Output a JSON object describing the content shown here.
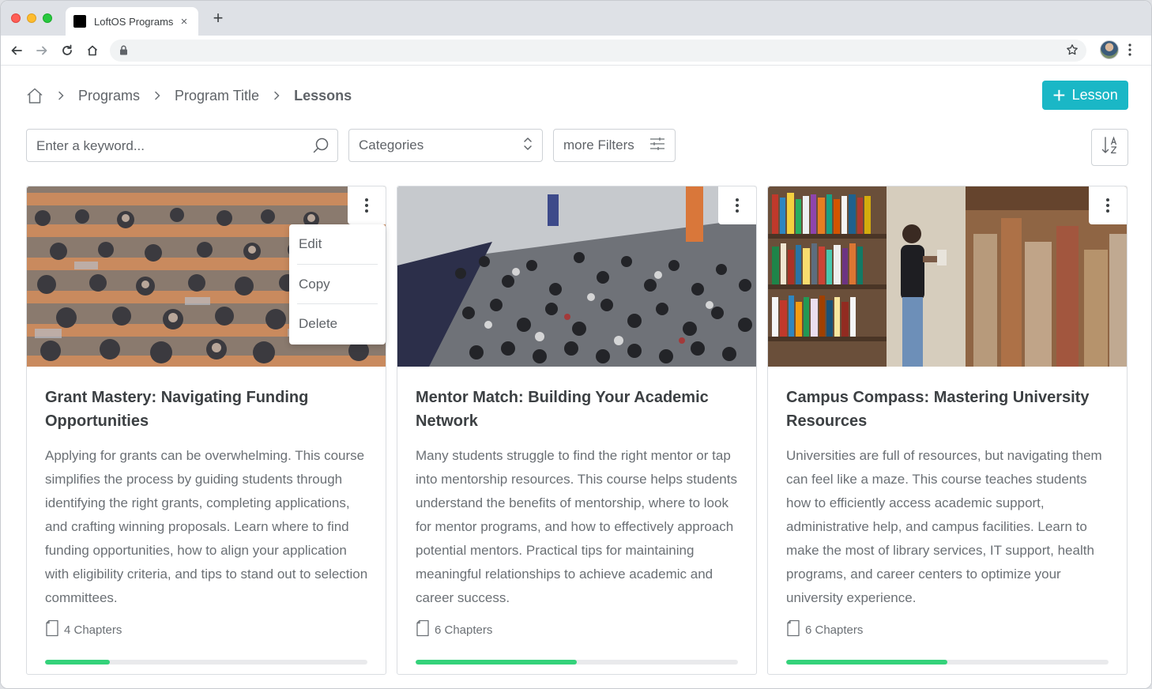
{
  "browser": {
    "tab_title": "LoftOS Programs",
    "tab_close": "×",
    "new_tab": "+"
  },
  "breadcrumb": {
    "items": [
      "Programs",
      "Program Title",
      "Lessons"
    ]
  },
  "add_button": {
    "label": "Lesson",
    "plus": "+"
  },
  "filters": {
    "search_placeholder": "Enter a keyword...",
    "categories_label": "Categories",
    "more_filters_label": "more Filters"
  },
  "colors": {
    "accent": "#1ab7c6",
    "progress": "#34d27a"
  },
  "cards": [
    {
      "title": "Grant Mastery: Navigating Funding Opportunities",
      "description": "Applying for grants can be overwhelming. This course simplifies the process by guiding students through identifying the right grants, completing applications, and crafting winning proposals. Learn where to find funding opportunities, how to align your application with eligibility criteria, and tips to stand out to selection committees.",
      "chapters": "4 Chapters",
      "progress": 0.2,
      "menu_open": true
    },
    {
      "title": "Mentor Match: Building Your Academic Network",
      "description": "Many students struggle to find the right mentor or tap into mentorship resources. This course helps students understand the benefits of mentorship, where to look for mentor programs, and how to effectively approach potential mentors. Practical tips for maintaining meaningful relationships to achieve academic and career success.",
      "chapters": "6 Chapters",
      "progress": 0.5,
      "menu_open": false
    },
    {
      "title": "Campus Compass: Mastering University Resources",
      "description": "Universities are full of resources, but navigating them can feel like a maze. This course teaches students how to efficiently access academic support, administrative help, and campus facilities. Learn to make the most of library services, IT support, health programs, and career centers to optimize your university experience.",
      "chapters": "6 Chapters",
      "progress": 0.5,
      "menu_open": false
    }
  ],
  "card_menu": {
    "items": [
      "Edit",
      "Copy",
      "Delete"
    ]
  }
}
